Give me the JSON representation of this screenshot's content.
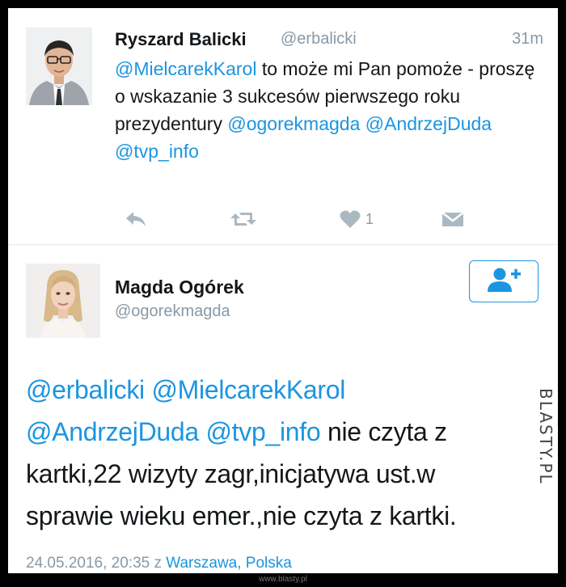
{
  "tweet1": {
    "author_name": "Ryszard Balicki",
    "author_handle": "@erbalicki",
    "time": "31m",
    "text_mention1": "@MielcarekKarol",
    "text_body": " to może mi Pan pomoże - proszę o wskazanie 3 sukcesów pierwszego roku prezydentury ",
    "text_mention2": "@ogorekmagda",
    "text_mention3": "@AndrzejDuda",
    "text_mention4": "@tvp_info",
    "like_count": "1",
    "icons": [
      "reply-icon",
      "retweet-icon",
      "heart-icon",
      "direct-message-icon"
    ]
  },
  "tweet2": {
    "author_name": "Magda Ogórek",
    "author_handle": "@ogorekmagda",
    "follow_icon": "follow-user-icon",
    "text_mention1": "@erbalicki",
    "text_mention2": "@MielcarekKarol",
    "text_mention3": "@AndrzejDuda",
    "text_mention4": "@tvp_info",
    "text_body": " nie czyta z kartki,22 wizyty zagr,inicjatywa ust.w sprawie wieku emer.,nie czyta z kartki.",
    "date": "24.05.2016, 20:35",
    "date_sep": " z ",
    "location": "Warszawa, Polska"
  },
  "watermark": {
    "side": "BLASTY.PL",
    "bottom": "www.blasty.pl"
  },
  "colors": {
    "link": "#1b95e0",
    "secondary": "#8899a6",
    "text": "#14171a"
  }
}
